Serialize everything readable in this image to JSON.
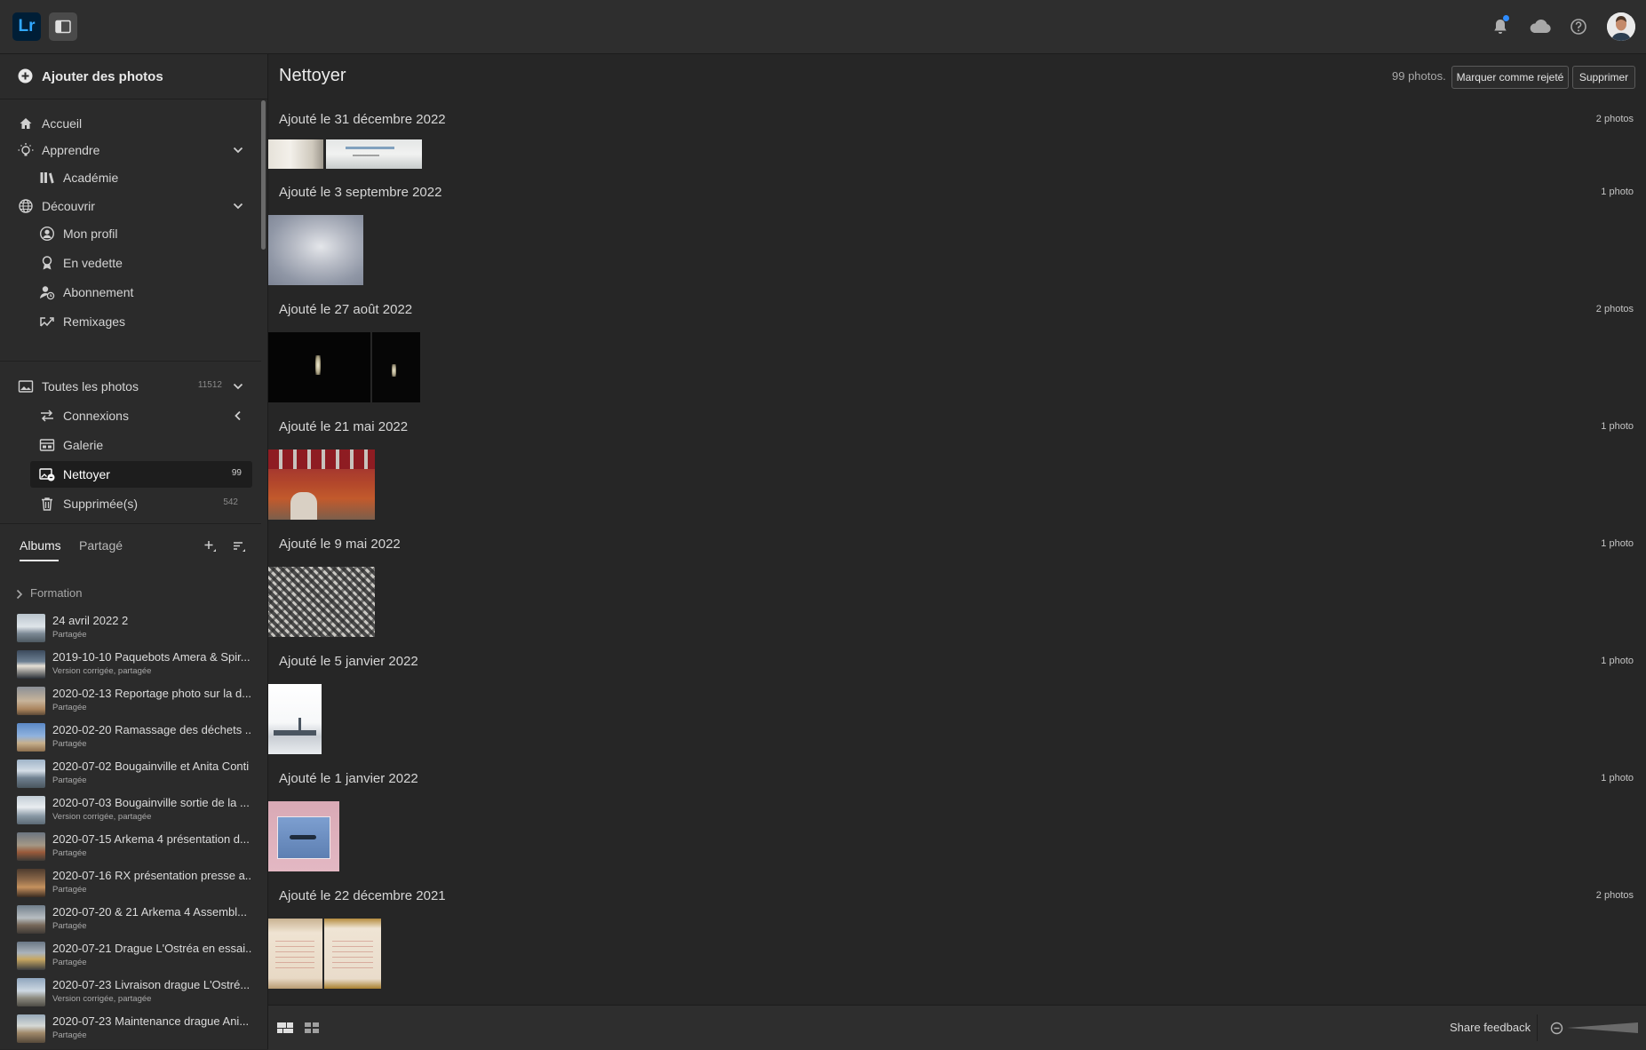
{
  "app": {
    "logo_text": "Lr",
    "accent": "#31a8ff"
  },
  "topbar": {
    "icons": [
      "panel-toggle-icon",
      "bell-icon",
      "cloud-icon",
      "help-icon",
      "avatar"
    ]
  },
  "sidebar": {
    "add_photos": "Ajouter des photos",
    "nav": {
      "accueil": "Accueil",
      "apprendre": "Apprendre",
      "academie": "Académie",
      "decouvrir": "Découvrir",
      "mon_profil": "Mon profil",
      "en_vedette": "En vedette",
      "abonnement": "Abonnement",
      "remixages": "Remixages",
      "toutes": "Toutes les photos",
      "toutes_count": "11512",
      "connexions": "Connexions",
      "galerie": "Galerie",
      "nettoyer": "Nettoyer",
      "nettoyer_count": "99",
      "supprimees": "Supprimée(s)",
      "supprimees_count": "542"
    },
    "tabs": {
      "albums": "Albums",
      "partage": "Partagé"
    },
    "folder": "Formation",
    "albums": [
      {
        "name": "24 avril 2022 2",
        "sub": "Partagée"
      },
      {
        "name": "2019-10-10 Paquebots Amera & Spir...",
        "sub": "Version corrigée, partagée"
      },
      {
        "name": "2020-02-13 Reportage photo sur la d...",
        "sub": "Partagée"
      },
      {
        "name": "2020-02-20 Ramassage des déchets ...",
        "sub": "Partagée"
      },
      {
        "name": "2020-07-02 Bougainville et Anita Conti",
        "sub": "Partagée"
      },
      {
        "name": "2020-07-03 Bougainville sortie de la ...",
        "sub": "Version corrigée, partagée"
      },
      {
        "name": "2020-07-15 Arkema 4 présentation d...",
        "sub": "Partagée"
      },
      {
        "name": "2020-07-16 RX présentation presse a...",
        "sub": "Partagée"
      },
      {
        "name": "2020-07-20 & 21 Arkema 4 Assembl...",
        "sub": "Partagée"
      },
      {
        "name": "2020-07-21 Drague L'Ostréa en essai...",
        "sub": "Partagée"
      },
      {
        "name": "2020-07-23 Livraison drague L'Ostré...",
        "sub": "Version corrigée, partagée"
      },
      {
        "name": "2020-07-23 Maintenance drague Ani...",
        "sub": "Partagée"
      }
    ]
  },
  "main": {
    "title": "Nettoyer",
    "photo_count": "99 photos.",
    "btn_reject": "Marquer comme rejeté",
    "btn_delete": "Supprimer",
    "groups": [
      {
        "title": "Ajouté le 31 décembre 2022",
        "count": "2 photos"
      },
      {
        "title": "Ajouté le 3 septembre 2022",
        "count": "1 photo"
      },
      {
        "title": "Ajouté le 27 août 2022",
        "count": "2 photos"
      },
      {
        "title": "Ajouté le 21 mai 2022",
        "count": "1 photo"
      },
      {
        "title": "Ajouté le 9 mai 2022",
        "count": "1 photo"
      },
      {
        "title": "Ajouté le 5 janvier 2022",
        "count": "1 photo"
      },
      {
        "title": "Ajouté le 1 janvier 2022",
        "count": "1 photo"
      },
      {
        "title": "Ajouté le 22 décembre 2021",
        "count": "2 photos"
      }
    ]
  },
  "bottombar": {
    "share_feedback": "Share feedback"
  }
}
